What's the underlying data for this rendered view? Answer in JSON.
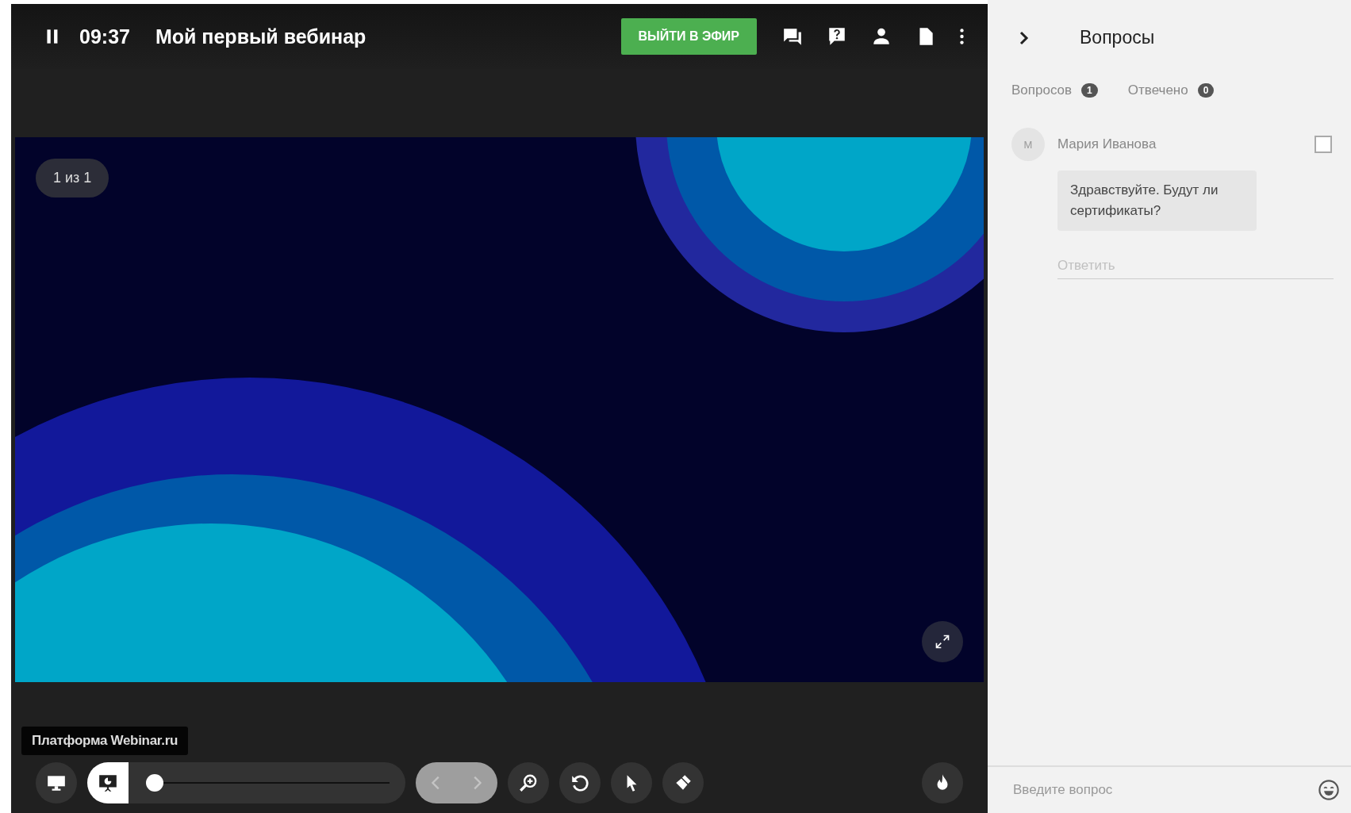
{
  "header": {
    "timer": "09:37",
    "title": "Мой первый вебинар",
    "go_live_button": "ВЫЙТИ В ЭФИР"
  },
  "slide": {
    "counter": "1 из 1"
  },
  "tooltip": "Платформа Webinar.ru",
  "toolbar": {
    "modes": [
      {
        "kind": "screen",
        "selected": false
      },
      {
        "kind": "slides",
        "selected": true
      }
    ],
    "slide_position": {
      "level": 0
    },
    "navigation": {
      "disabled": true
    }
  },
  "panel": {
    "title": "Вопросы",
    "tabs": [
      {
        "label": "Вопросов",
        "count": "1",
        "selected": false
      },
      {
        "label": "Отвечено",
        "count": "0",
        "selected": false
      }
    ],
    "questions": [
      {
        "initial": "М",
        "author": "Мария Иванова",
        "text": "Здравствуйте. Будут ли сертификаты?",
        "checked": false,
        "reply_placeholder": "Ответить"
      }
    ],
    "input": {
      "placeholder": "Введите вопрос"
    }
  }
}
